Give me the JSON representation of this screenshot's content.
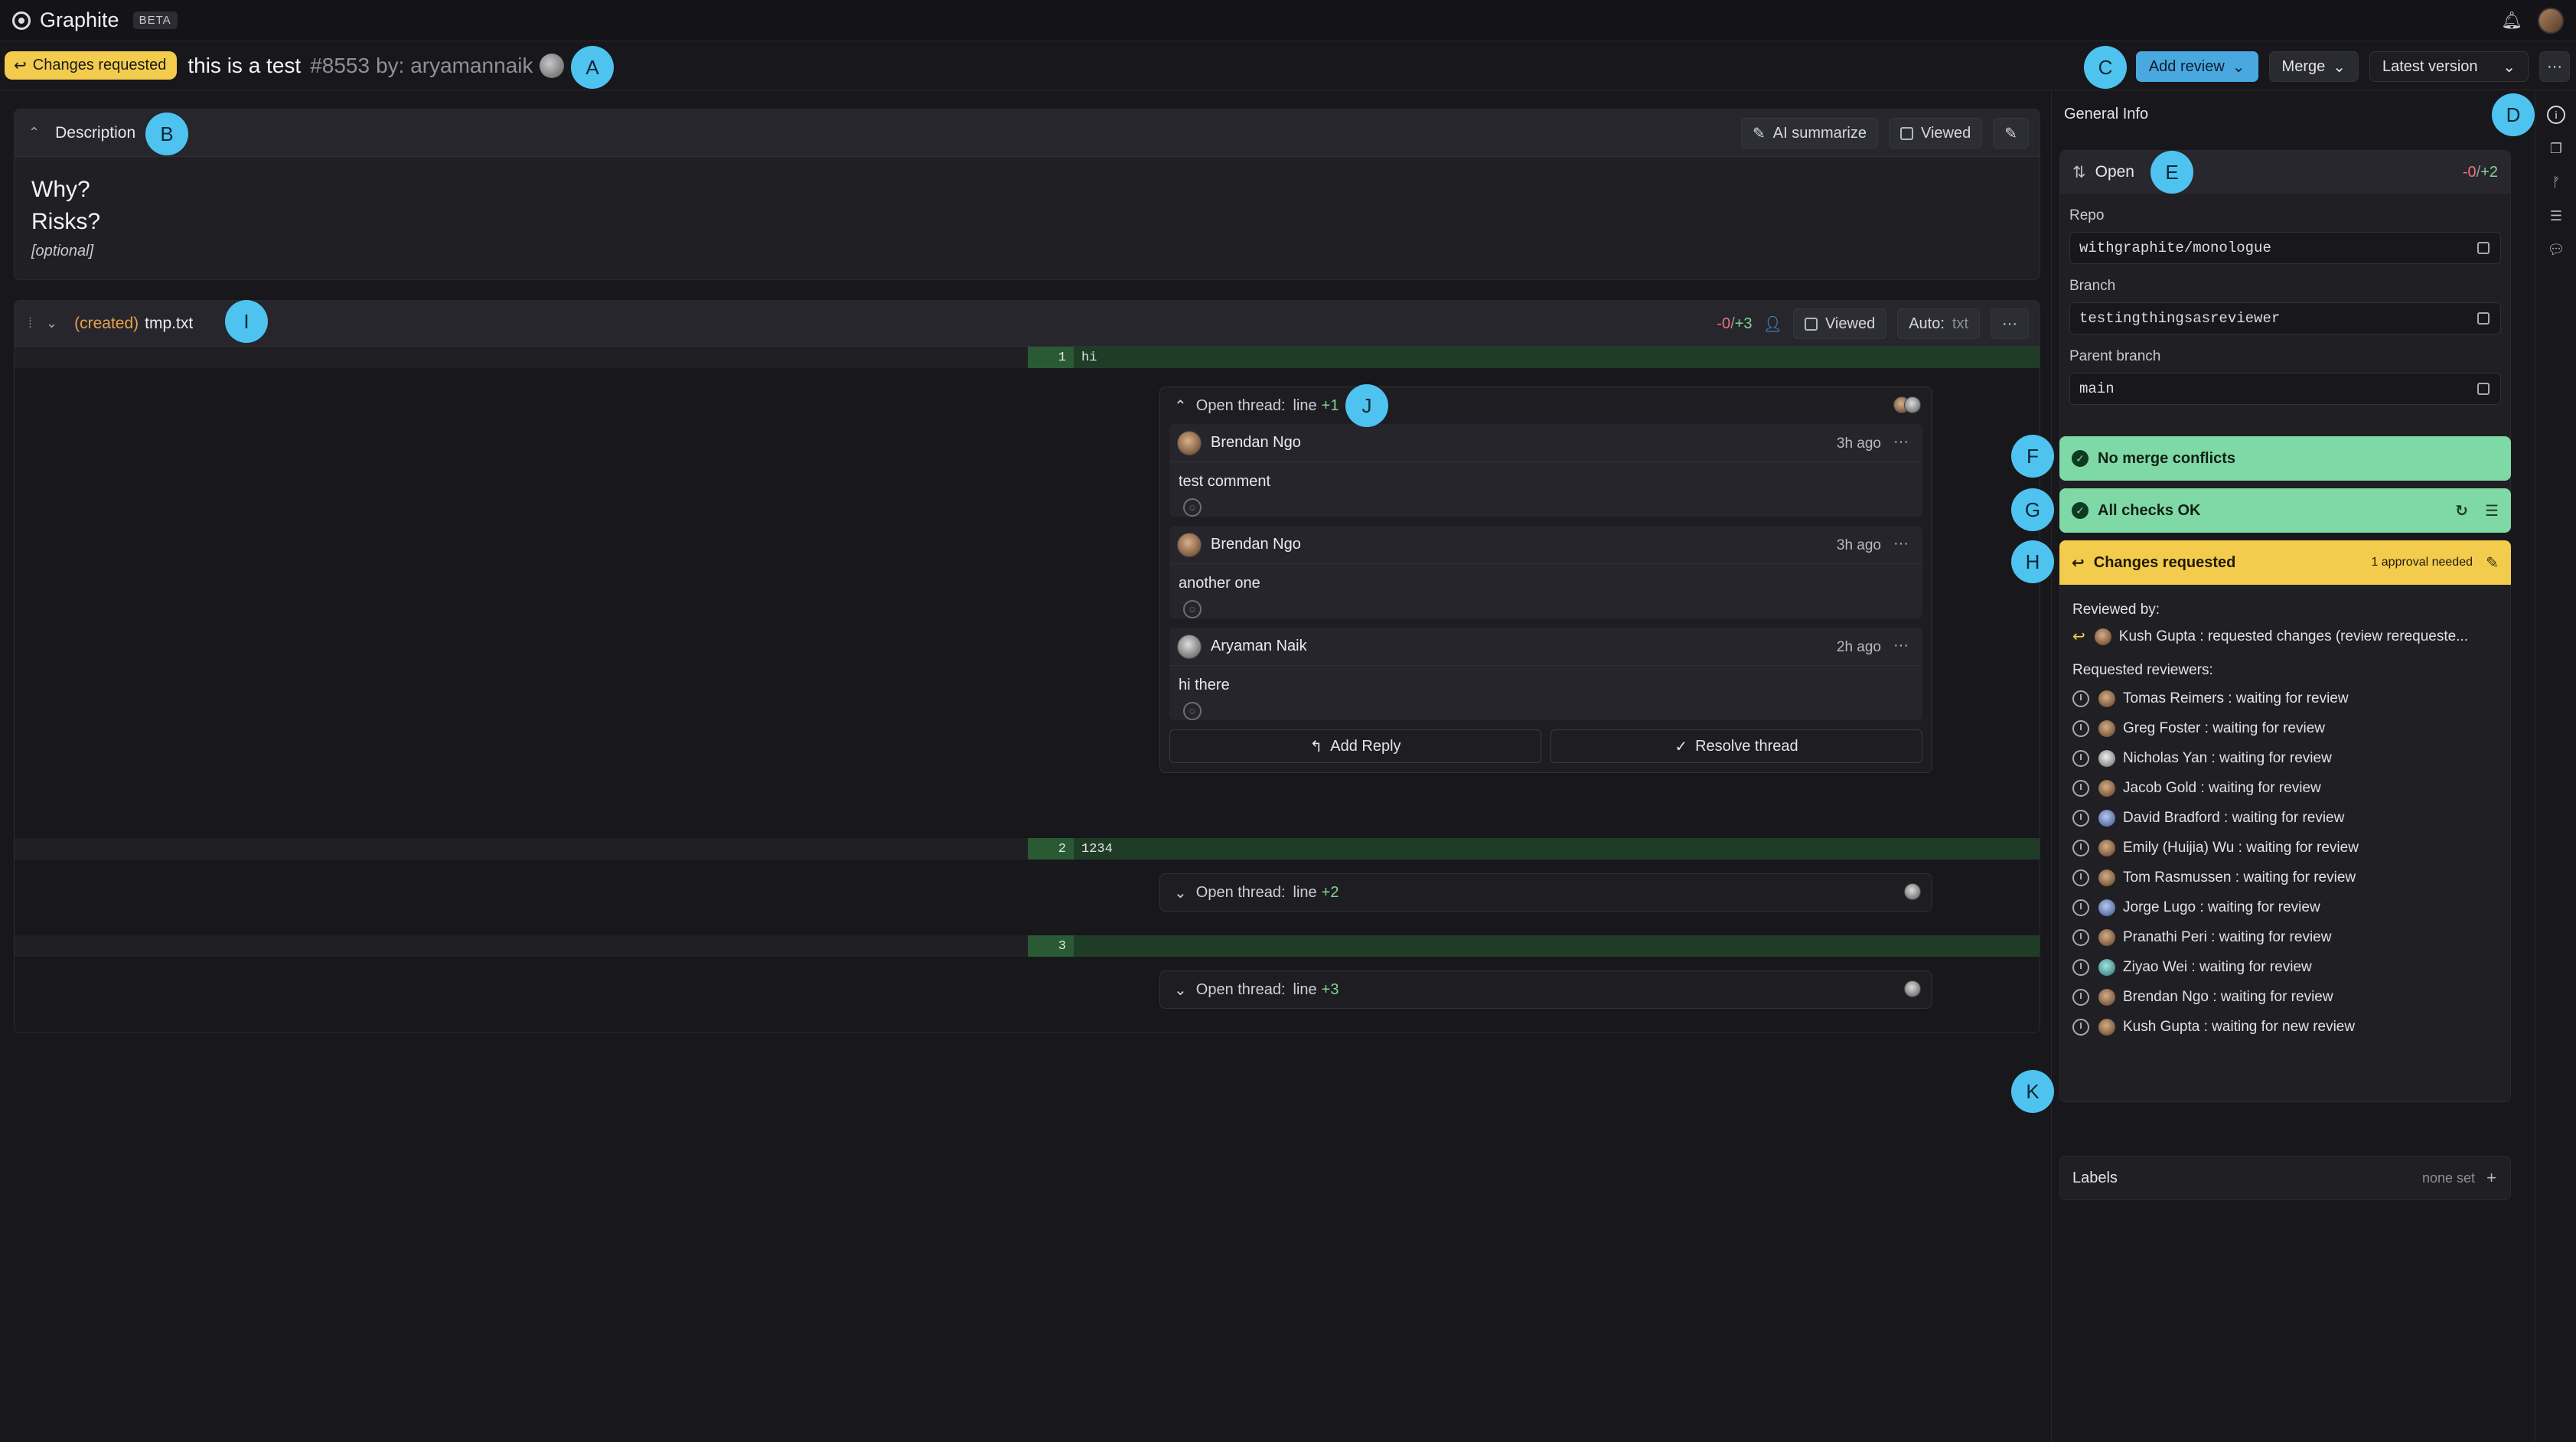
{
  "app": {
    "name": "Graphite",
    "badge": "BETA"
  },
  "pr": {
    "status": "Changes requested",
    "title": "this is a test",
    "number": "#8553",
    "by": "by: aryamannaik"
  },
  "header_actions": {
    "add_review": "Add review",
    "merge": "Merge",
    "version": "Latest version",
    "more": "···"
  },
  "markers": [
    "A",
    "B",
    "C",
    "D",
    "E",
    "F",
    "G",
    "H",
    "I",
    "J",
    "K"
  ],
  "description": {
    "label": "Description",
    "ai_summarize": "AI summarize",
    "viewed": "Viewed",
    "lines": [
      "Why?",
      "Risks?"
    ],
    "optional": "[optional]"
  },
  "file": {
    "created": "(created)",
    "name": "tmp.txt",
    "deletions": "-0",
    "additions": "+3",
    "viewed": "Viewed",
    "auto": "Auto:",
    "auto_ext": "txt",
    "lines": [
      {
        "num": "1",
        "code": "hi"
      },
      {
        "num": "2",
        "code": "1234"
      },
      {
        "num": "3",
        "code": ""
      }
    ]
  },
  "threads": [
    {
      "label": "Open thread:",
      "line_word": "line",
      "line": "+1",
      "comments": [
        {
          "author": "Brendan Ngo",
          "time": "3h ago",
          "body": "test comment"
        },
        {
          "author": "Brendan Ngo",
          "time": "3h ago",
          "body": "another one"
        },
        {
          "author": "Aryaman Naik",
          "time": "2h ago",
          "body": "hi there"
        }
      ],
      "add_reply": "Add Reply",
      "resolve": "Resolve thread"
    },
    {
      "label": "Open thread:",
      "line_word": "line",
      "line": "+2"
    },
    {
      "label": "Open thread:",
      "line_word": "line",
      "line": "+3"
    }
  ],
  "sidebar": {
    "title": "General Info",
    "state": "Open",
    "deletions": "-0",
    "additions": "+2",
    "repo_label": "Repo",
    "repo": "withgraphite/monologue",
    "branch_label": "Branch",
    "branch": "testingthingsasreviewer",
    "parent_label": "Parent branch",
    "parent": "main",
    "merge_conflicts": "No merge conflicts",
    "checks": "All checks OK",
    "changes_requested": "Changes requested",
    "approval_needed": "1 approval needed",
    "reviewed_by_label": "Reviewed by:",
    "reviewed_by": "Kush Gupta : requested changes (review rerequeste...",
    "requested_label": "Requested reviewers:",
    "requested": [
      "Tomas Reimers : waiting for review",
      "Greg Foster : waiting for review",
      "Nicholas Yan : waiting for review",
      "Jacob Gold : waiting for review",
      "David Bradford : waiting for review",
      "Emily (Huijia) Wu : waiting for review",
      "Tom Rasmussen : waiting for review",
      "Jorge Lugo : waiting for review",
      "Pranathi Peri : waiting for review",
      "Ziyao Wei : waiting for review",
      "Brendan Ngo : waiting for review",
      "Kush Gupta : waiting for new review"
    ],
    "labels": "Labels",
    "labels_value": "none set"
  }
}
